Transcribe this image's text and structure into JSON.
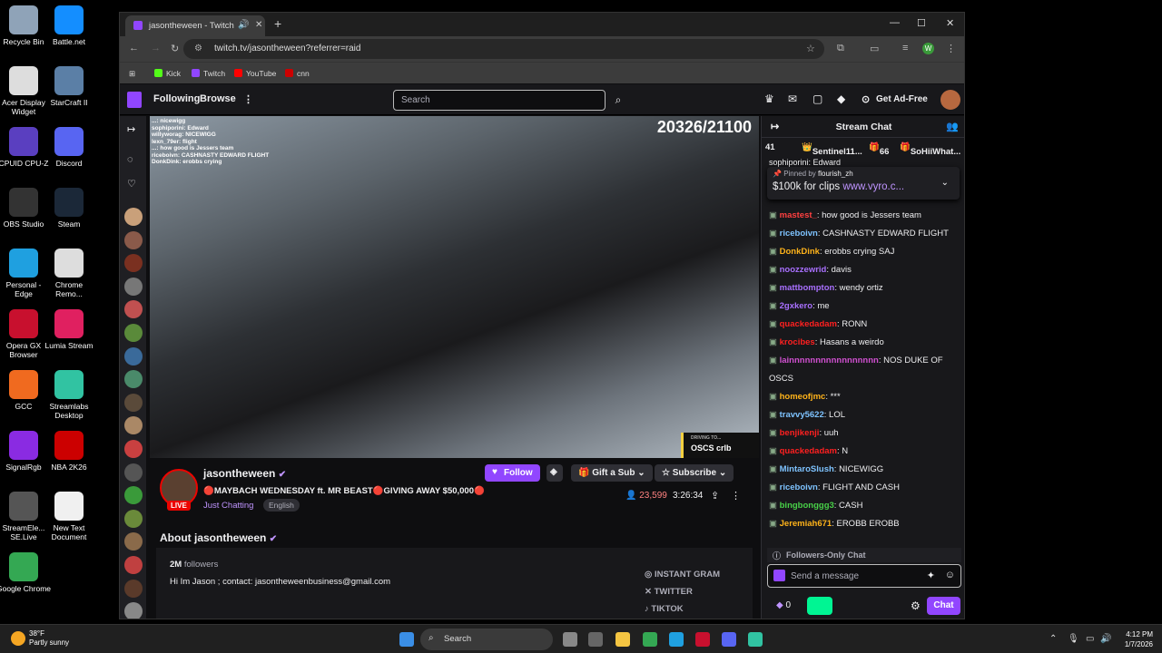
{
  "desktop": {
    "icons": [
      {
        "label": "Recycle Bin",
        "color": "#8fa3b8"
      },
      {
        "label": "Battle.net",
        "color": "#148eff"
      },
      {
        "label": "Acer Display Widget",
        "color": "#ddd"
      },
      {
        "label": "StarCraft II",
        "color": "#5b7fa6"
      },
      {
        "label": "CPUID CPU-Z",
        "color": "#5a3fc0"
      },
      {
        "label": "Discord",
        "color": "#5865f2"
      },
      {
        "label": "OBS Studio",
        "color": "#333"
      },
      {
        "label": "Steam",
        "color": "#1b2838"
      },
      {
        "label": "Personal - Edge",
        "color": "#1fa0e0"
      },
      {
        "label": "Chrome Remo...",
        "color": "#ddd"
      },
      {
        "label": "Opera GX Browser",
        "color": "#c8102e"
      },
      {
        "label": "Lumia Stream",
        "color": "#e02060"
      },
      {
        "label": "GCC",
        "color": "#f06a1f"
      },
      {
        "label": "Streamlabs Desktop",
        "color": "#31c3a2"
      },
      {
        "label": "SignalRgb",
        "color": "#8a2be2"
      },
      {
        "label": "NBA 2K26",
        "color": "#c00"
      },
      {
        "label": "StreamEle... SE.Live",
        "color": "#555"
      },
      {
        "label": "New Text Document",
        "color": "#f0f0f0"
      },
      {
        "label": "Google Chrome",
        "color": "#34a853"
      }
    ]
  },
  "browser": {
    "tab_title": "jasontheween - Twitch",
    "url": "twitch.tv/jasontheween?referrer=raid",
    "bookmarks": [
      {
        "label": "Kick",
        "color": "#53fc18"
      },
      {
        "label": "Twitch",
        "color": "#9146ff"
      },
      {
        "label": "YouTube",
        "color": "#ff0000"
      },
      {
        "label": "cnn",
        "color": "#cc0000"
      }
    ],
    "profile_initial": "W"
  },
  "twitch_nav": {
    "following": "Following",
    "browse": "Browse",
    "search_placeholder": "Search",
    "get_ad_free": "Get Ad-Free"
  },
  "player": {
    "viewer_overlay": "20326/21100",
    "overlay_chat": [
      "...: nicewigg",
      "sophiporini: Edward",
      "willyworag: NICEWIGG",
      "lexn_79er: flight",
      "...: how good is Jessers team",
      "riceboivn: CASHNASTY EDWARD FLIGHT",
      "DonkDink: erobbs crying"
    ],
    "oscs_small": "DRIVING TO...",
    "oscs_label": "OSCS crlb"
  },
  "stream_info": {
    "streamer": "jasontheween",
    "live_badge": "LIVE",
    "title": "🔴MAYBACH WEDNESDAY ft. MR BEAST🔴GIVING AWAY $50,000🔴",
    "category": "Just Chatting",
    "language": "English",
    "follow": "Follow",
    "gift_sub": "Gift a Sub",
    "subscribe": "Subscribe",
    "viewers": "23,599",
    "uptime": "3:26:34"
  },
  "about": {
    "heading": "About jasontheween",
    "followers_count": "2M",
    "followers_label": "followers",
    "bio": "Hi Im Jason ; contact: jasontheweenbusiness@gmail.com",
    "socials": [
      "INSTANT GRAM",
      "TWITTER",
      "TIKTOK"
    ]
  },
  "chat": {
    "title": "Stream Chat",
    "gift_row": {
      "count1": "41",
      "user1": "Sentinel11...",
      "count2": "66",
      "user2": "SoHiiWhat..."
    },
    "partial_top": "sophiporini: Edward",
    "pinned_by": "Pinned by",
    "pinned_user": "flourish_zh",
    "pinned_text": "$100k for clips",
    "pinned_link": "www.vyro.c...",
    "messages": [
      {
        "user": "mastest_",
        "text": ": how good is Jessers team",
        "color": "#ff4040"
      },
      {
        "user": "riceboivn",
        "text": ": CASHNASTY EDWARD FLIGHT",
        "color": "#7ec3ff"
      },
      {
        "user": "DonkDink",
        "text": ": erobbs crying SAJ",
        "color": "#ffb31a"
      },
      {
        "user": "noozzewrid",
        "text": ": davis",
        "color": "#a970ff"
      },
      {
        "user": "mattbompton",
        "text": ": wendy ortiz",
        "color": "#a970ff"
      },
      {
        "user": "2gxkero",
        "text": ": me",
        "color": "#a970ff"
      },
      {
        "user": "quackedadam",
        "text": ": RONN",
        "color": "#ff2020"
      },
      {
        "user": "krocibes",
        "text": ": Hasans a weirdo",
        "color": "#ff2020"
      },
      {
        "user": "lainnnnnnnnnnnnnnnnn",
        "text": ": NOS DUKE OF OSCS",
        "color": "#d050d0"
      },
      {
        "user": "homeofjmc",
        "text": ": ***",
        "color": "#ffb31a"
      },
      {
        "user": "travvy5622",
        "text": ": LOL",
        "color": "#7ec3ff"
      },
      {
        "user": "benjikenji",
        "text": ": uuh",
        "color": "#ff2020"
      },
      {
        "user": "quackedadam",
        "text": ": N",
        "color": "#ff2020"
      },
      {
        "user": "MintaroSlush",
        "text": ": NICEWIGG",
        "color": "#7ec3ff"
      },
      {
        "user": "riceboivn",
        "text": ": FLIGHT AND CASH",
        "color": "#7ec3ff"
      },
      {
        "user": "bingbonggg3",
        "text": ": CASH",
        "color": "#48d048"
      },
      {
        "user": "Jeremiah671",
        "text": ": EROBB EROBB",
        "color": "#ffb31a"
      }
    ],
    "followers_only": "Followers-Only Chat",
    "send_placeholder": "Send a message",
    "points": "0",
    "chat_button": "Chat"
  },
  "taskbar": {
    "temp": "38°F",
    "weather": "Partly sunny",
    "search": "Search",
    "time": "4:12 PM",
    "date": "1/7/2026"
  }
}
